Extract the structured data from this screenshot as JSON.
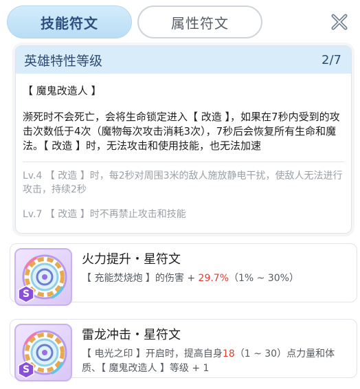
{
  "tabs": {
    "active_label": "技能符文",
    "inactive_label": "属性符文"
  },
  "close_icon": "close-icon",
  "trait": {
    "title": "英雄特性等级",
    "page": "2/7",
    "name": "【 魔鬼改造人 】",
    "description": "濒死时不会死亡，会将生命锁定进入【 改造 】，如果在7秒内受到的攻击次数低于4次（魔物每次攻击消耗3次），7秒后会恢复所有生命和魔法。【 改造 】时，无法攻击和使用技能，也无法加速",
    "lv4": "Lv.4 【 改造 】时，每2秒对周围3米的敌人施放静电干扰，使敌人无法进行攻击，持续2秒",
    "lv7": "Lv.7 【 改造 】时不再禁止攻击和技能"
  },
  "runes": [
    {
      "title": "火力提升・星符文",
      "desc_before": "【 充能焚烧炮 】的伤害 + ",
      "desc_highlight": "29.7%",
      "desc_after": "（1% ~ 30%）",
      "badge": "S",
      "icon": "rune-gear-icon"
    },
    {
      "title": "雷龙冲击・星符文",
      "desc_before": "【 电光之印 】开启时，提高自身",
      "desc_highlight": "18",
      "desc_after": "（1 ~ 30）点力量和体质、【 魔鬼改造人 】等级 + 1",
      "badge": "S",
      "icon": "rune-gear-icon"
    }
  ],
  "colors": {
    "tab_active_bg": "#c6e4f8",
    "header_bg": "#d8ecfa",
    "highlight": "#e23b2e",
    "badge": "#8a4fd8"
  }
}
